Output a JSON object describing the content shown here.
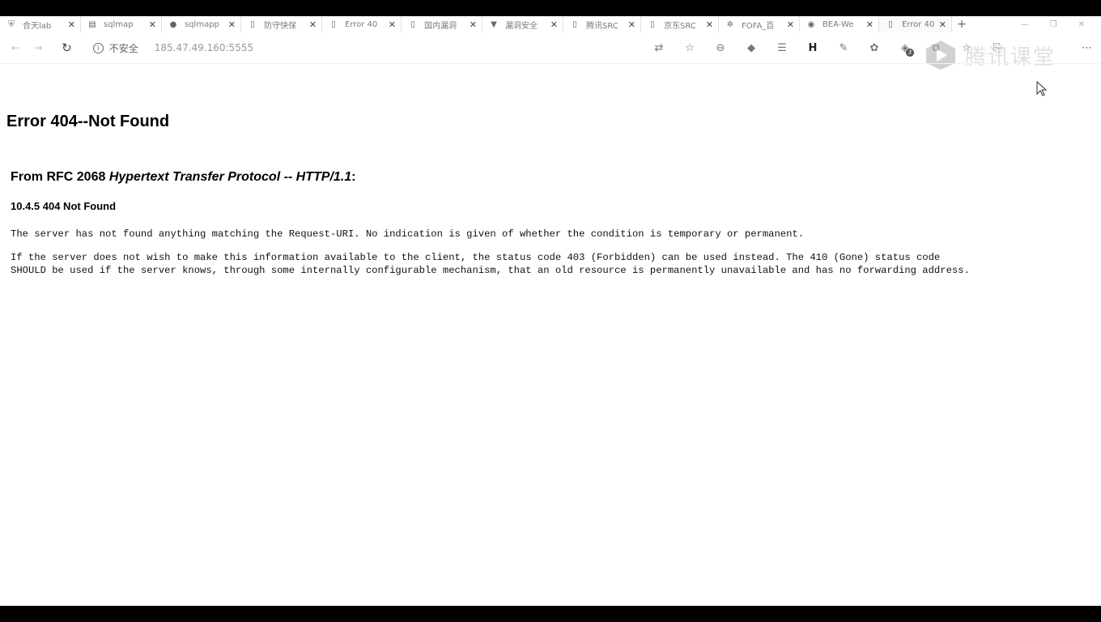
{
  "tabs": [
    {
      "title": "合天lab",
      "icon": "shield-icon",
      "active": false
    },
    {
      "title": "sqlmap",
      "icon": "sql-icon",
      "active": false
    },
    {
      "title": "sqlmapp",
      "icon": "github-icon",
      "active": false
    },
    {
      "title": "防守快保",
      "icon": "page-icon",
      "active": false
    },
    {
      "title": "Error 40",
      "icon": "page-icon",
      "active": false
    },
    {
      "title": "国内漏洞",
      "icon": "page-icon",
      "active": false
    },
    {
      "title": "漏洞安全",
      "icon": "triangle-icon",
      "active": false
    },
    {
      "title": "腾讯SRC",
      "icon": "page-icon",
      "active": false
    },
    {
      "title": "京东SRC",
      "icon": "page-icon",
      "active": false
    },
    {
      "title": "FOFA_百",
      "icon": "gear-icon",
      "active": false
    },
    {
      "title": "BEA-We",
      "icon": "circle-icon",
      "active": false
    },
    {
      "title": "Error 40",
      "icon": "page-icon",
      "active": true
    }
  ],
  "address_bar": {
    "security_label": "不安全",
    "url": "185.47.49.160:5555"
  },
  "watermark": {
    "text": "腾讯课堂"
  },
  "extension_badge": "3",
  "page": {
    "heading": "Error 404--Not Found",
    "rfc_prefix": "From RFC 2068 ",
    "rfc_italic": "Hypertext Transfer Protocol -- HTTP/1.1",
    "rfc_suffix": ":",
    "section": "10.4.5 404 Not Found",
    "paragraph1": "The server has not found anything matching the Request-URI. No indication is given of whether the condition is temporary or permanent.",
    "paragraph2_line1": "If the server does not wish to make this information available to the client, the status code 403 (Forbidden) can be used instead. The 410 (Gone) status code",
    "paragraph2_line2": "SHOULD be used if the server knows, through some internally configurable mechanism, that an old resource is permanently unavailable and has no forwarding address."
  }
}
